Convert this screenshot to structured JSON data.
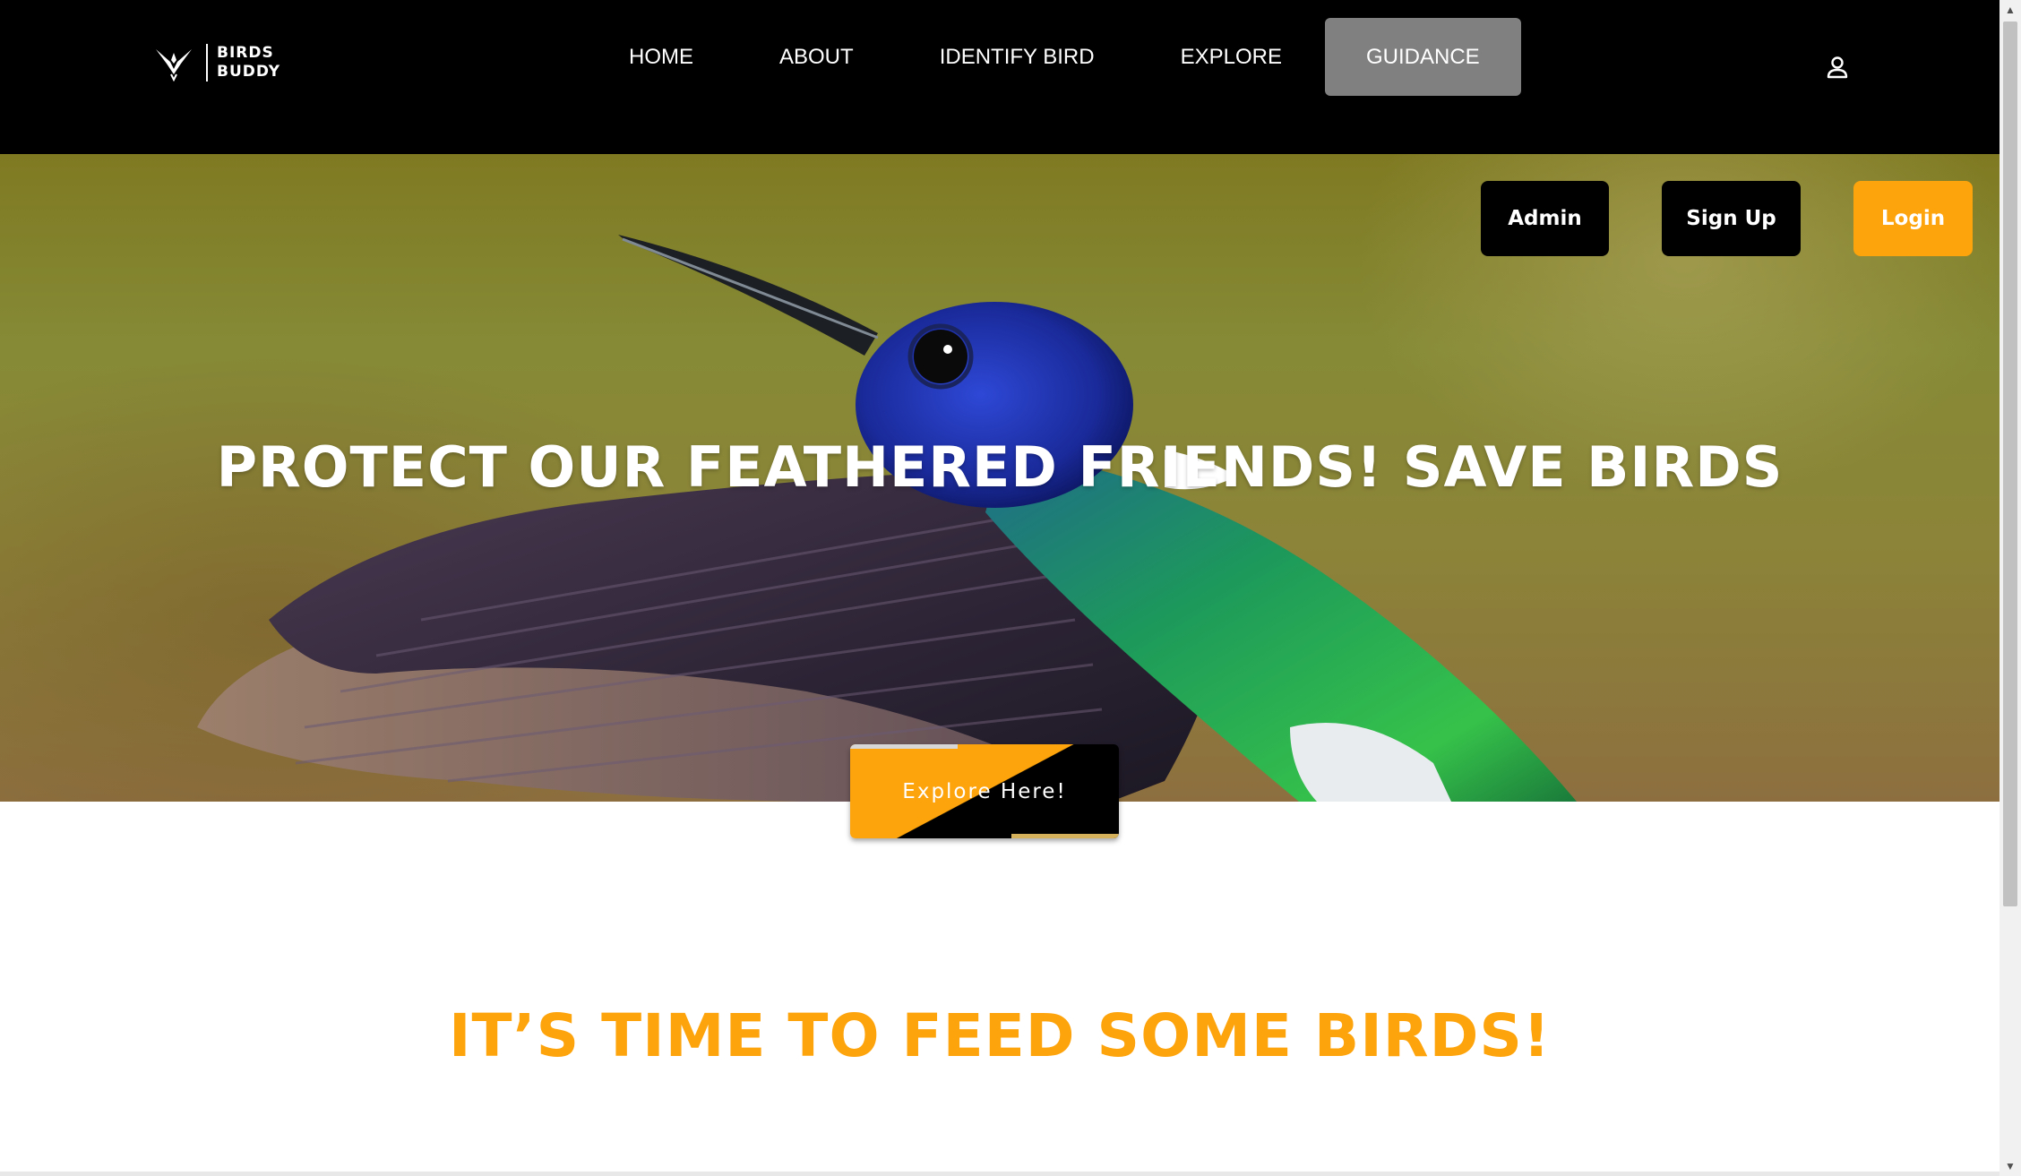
{
  "brand": {
    "line1": "BIRDS",
    "line2": "BUDDY"
  },
  "nav": {
    "items": [
      {
        "label": "HOME"
      },
      {
        "label": "ABOUT"
      },
      {
        "label": "IDENTIFY BIRD"
      },
      {
        "label": "EXPLORE"
      },
      {
        "label": "GUIDANCE",
        "active": true
      }
    ]
  },
  "auth": {
    "admin": "Admin",
    "signup": "Sign Up",
    "login": "Login"
  },
  "hero": {
    "title": "PROTECT OUR FEATHERED FRIENDS! SAVE BIRDS",
    "cta": "Explore Here!"
  },
  "section": {
    "title": "IT’S TIME TO FEED SOME BIRDS!"
  },
  "colors": {
    "accent": "#fda30b",
    "nav_bg": "#000000",
    "active_tab": "#808080"
  },
  "icons": {
    "user": "user-icon",
    "logo": "bird-logo-icon"
  }
}
